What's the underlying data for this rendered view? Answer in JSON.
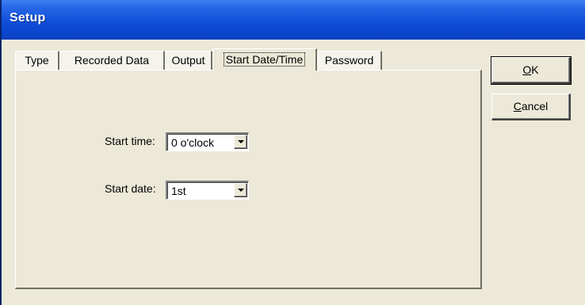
{
  "window": {
    "title": "Setup"
  },
  "tabs": [
    {
      "label": "Type"
    },
    {
      "label": "Recorded Data"
    },
    {
      "label": "Output"
    },
    {
      "label": "Start Date/Time",
      "selected": true
    },
    {
      "label": "Password"
    }
  ],
  "form": {
    "start_time_label": "Start time:",
    "start_time_value": "0 o'clock",
    "start_date_label": "Start date:",
    "start_date_value": "1st"
  },
  "buttons": {
    "ok_mnemonic": "O",
    "ok_rest": "K",
    "cancel_mnemonic": "C",
    "cancel_rest": "ancel"
  },
  "icons": {
    "dropdown": "chevron-down-icon"
  },
  "colors": {
    "title_bar": "#0a45cc",
    "dialog_face": "#ece9d8"
  }
}
